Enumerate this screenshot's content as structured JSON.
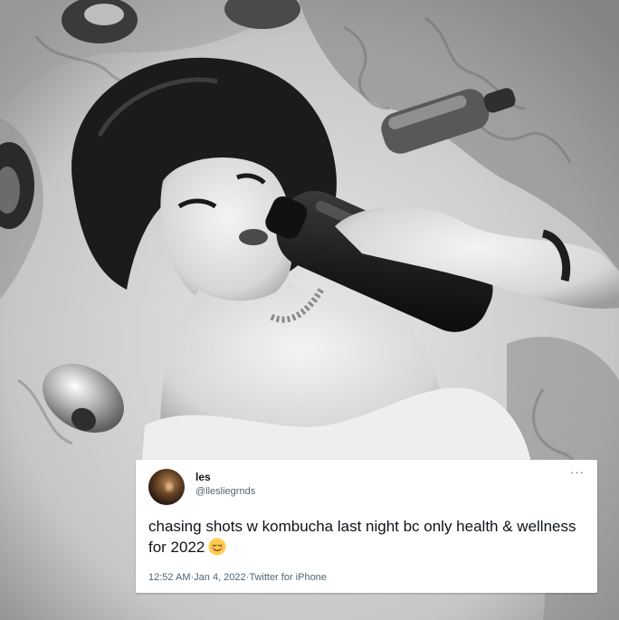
{
  "tweet": {
    "display_name": "les",
    "handle": "@llesliegrnds",
    "text": "chasing shots w kombucha last night bc only health & wellness for 2022",
    "emoji": "relieved-face",
    "time": "12:52 AM",
    "date": "Jan 4, 2022",
    "source": "Twitter for iPhone",
    "more_label": "···",
    "separator": " · "
  }
}
